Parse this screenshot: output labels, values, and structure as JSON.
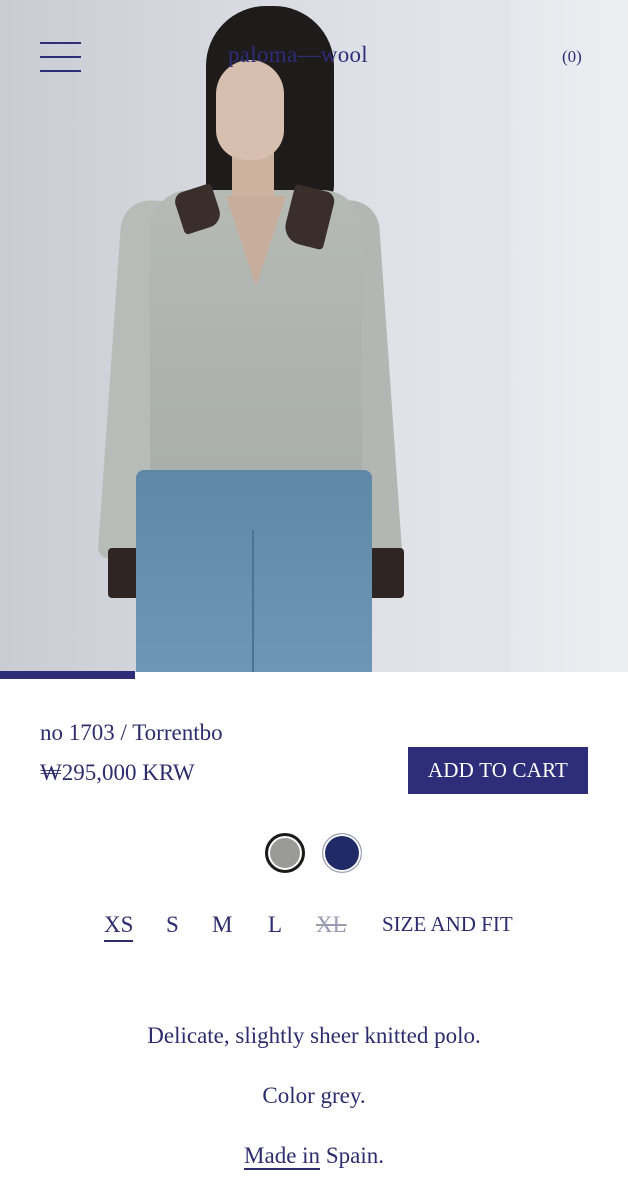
{
  "header": {
    "logo": "paloma—wool",
    "cart_count": "(0)"
  },
  "product": {
    "name": "no 1703 / Torrentbo",
    "price": "₩295,000 KRW",
    "add_to_cart_label": "ADD TO CART",
    "image_progress": 0.215,
    "colors": [
      {
        "name": "grey",
        "hex": "#9a9a98",
        "selected": true
      },
      {
        "name": "navy",
        "hex": "#1f2a66",
        "selected": false
      }
    ],
    "sizes": [
      {
        "label": "XS",
        "selected": true,
        "available": true
      },
      {
        "label": "S",
        "selected": false,
        "available": true
      },
      {
        "label": "M",
        "selected": false,
        "available": true
      },
      {
        "label": "L",
        "selected": false,
        "available": true
      },
      {
        "label": "XL",
        "selected": false,
        "available": false
      }
    ],
    "size_and_fit_label": "SIZE AND FIT",
    "description": {
      "line1": "Delicate, slightly sheer knitted polo.",
      "line2": "Color grey.",
      "made_in_link": "Made in",
      "made_in_rest": " Spain."
    }
  },
  "colors": {
    "accent": "#2d2d7a",
    "text": "#2d2d6e"
  }
}
